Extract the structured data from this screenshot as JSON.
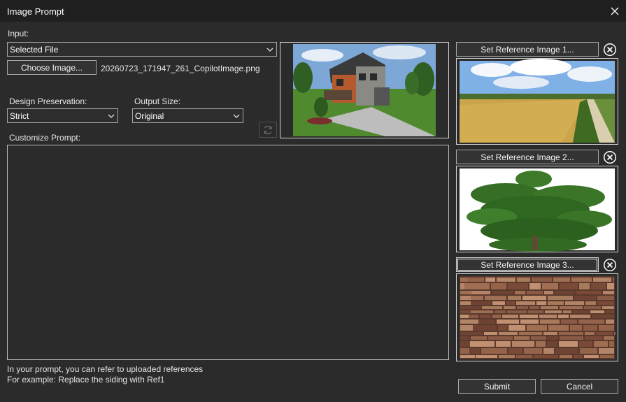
{
  "window": {
    "title": "Image Prompt"
  },
  "input": {
    "label": "Input:",
    "source_selected": "Selected File",
    "choose_button": "Choose Image...",
    "filename": "20260723_171947_261_CopilotImage.png"
  },
  "design_preservation": {
    "label": "Design Preservation:",
    "selected": "Strict"
  },
  "output_size": {
    "label": "Output Size:",
    "selected": "Original"
  },
  "prompt": {
    "label": "Customize Prompt:",
    "value": ""
  },
  "references": [
    {
      "button": "Set Reference Image 1...",
      "thumbnail": "wheat-field-thumbnail"
    },
    {
      "button": "Set Reference Image 2...",
      "thumbnail": "tree-thumbnail"
    },
    {
      "button": "Set Reference Image 3...",
      "thumbnail": "stone-wall-thumbnail"
    }
  ],
  "hint": {
    "line1": "In your prompt, you can refer to uploaded references",
    "line2": "For example: Replace the siding with Ref1"
  },
  "actions": {
    "submit": "Submit",
    "cancel": "Cancel"
  },
  "icons": {
    "close": "close-icon",
    "dropdown": "chevron-down-icon",
    "refresh": "refresh-icon",
    "remove": "circle-x-icon"
  }
}
